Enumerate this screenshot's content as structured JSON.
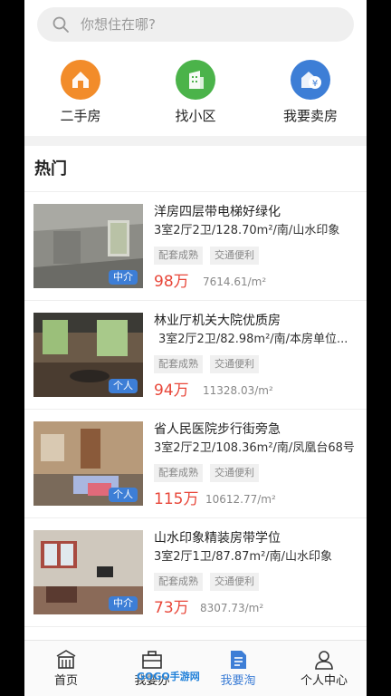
{
  "search": {
    "placeholder": "你想住在哪?"
  },
  "categories": [
    {
      "label": "二手房",
      "icon": "house-icon",
      "color": "#f28c2a"
    },
    {
      "label": "找小区",
      "icon": "building-icon",
      "color": "#4bb34a"
    },
    {
      "label": "我要卖房",
      "icon": "sell-house-icon",
      "color": "#3d7ed6"
    }
  ],
  "section_title": "热门",
  "listings": [
    {
      "title": "洋房四层带电梯好绿化",
      "desc": "3室2厅2卫/128.70m²/南/山水印象",
      "tags": [
        "配套成熟",
        "交通便利"
      ],
      "price": "98万",
      "unit_price": "7614.61/m²",
      "badge": "中介"
    },
    {
      "title": "林业厅机关大院优质房",
      "desc": "3室2厅2卫/82.98m²/南/本房单位...",
      "tags": [
        "配套成熟",
        "交通便利"
      ],
      "price": "94万",
      "unit_price": "11328.03/m²",
      "badge": "个人"
    },
    {
      "title": "省人民医院步行街旁急",
      "desc": "3室2厅2卫/108.36m²/南/凤凰台68号",
      "tags": [
        "配套成熟",
        "交通便利"
      ],
      "price": "115万",
      "unit_price": "10612.77/m²",
      "badge": "个人"
    },
    {
      "title": "山水印象精装房带学位",
      "desc": "3室2厅1卫/87.87m²/南/山水印象",
      "tags": [
        "配套成熟",
        "交通便利"
      ],
      "price": "73万",
      "unit_price": "8307.73/m²",
      "badge": "中介"
    }
  ],
  "tabbar": [
    {
      "label": "首页",
      "icon": "home-icon",
      "active": false
    },
    {
      "label": "我要办",
      "icon": "briefcase-icon",
      "active": false
    },
    {
      "label": "我要淘",
      "icon": "document-icon",
      "active": true
    },
    {
      "label": "个人中心",
      "icon": "user-icon",
      "active": false
    }
  ],
  "watermark": "GOGO手游网",
  "colors": {
    "accent": "#3d7ed6",
    "price": "#e8473a"
  }
}
